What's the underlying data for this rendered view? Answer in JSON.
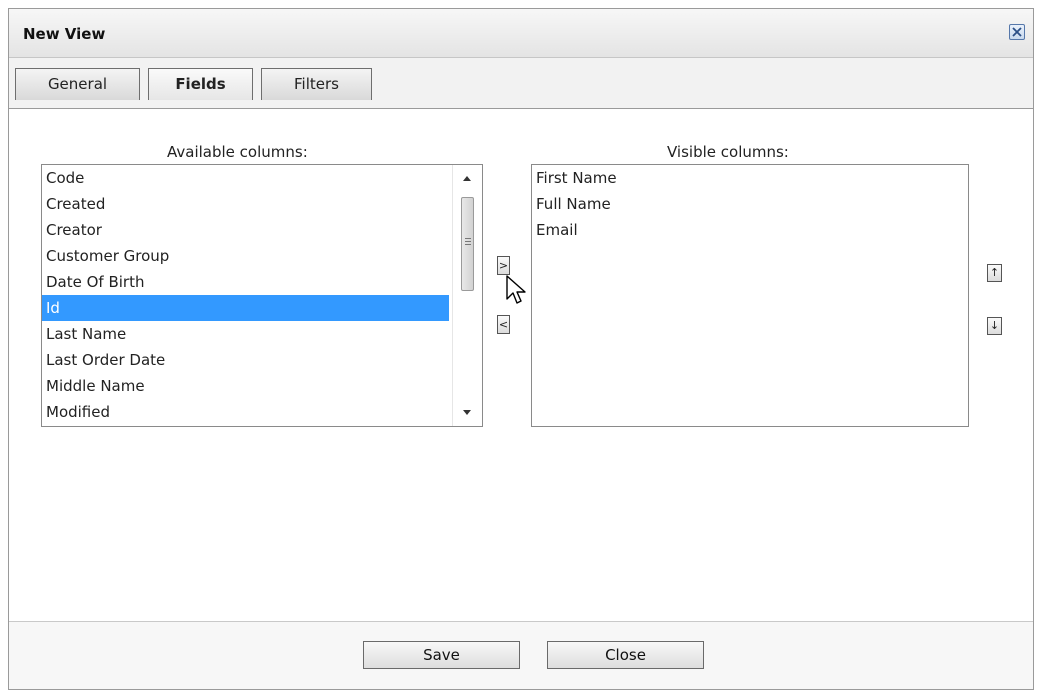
{
  "dialog": {
    "title": "New View"
  },
  "tabs": [
    {
      "label": "General",
      "active": false
    },
    {
      "label": "Fields",
      "active": true
    },
    {
      "label": "Filters",
      "active": false
    }
  ],
  "available": {
    "label": "Available columns:",
    "items": [
      "Code",
      "Created",
      "Creator",
      "Customer Group",
      "Date Of Birth",
      "Id",
      "Last Name",
      "Last Order Date",
      "Middle Name",
      "Modified"
    ],
    "selected": "Id"
  },
  "visible": {
    "label": "Visible columns:",
    "items": [
      "First Name",
      "Full Name",
      "Email"
    ]
  },
  "buttons": {
    "add": ">",
    "remove": "<",
    "move_up": "↑",
    "move_down": "↓",
    "save": "Save",
    "close": "Close"
  },
  "icons": {
    "close": "close-icon",
    "cursor": "arrow-cursor-icon"
  },
  "colors": {
    "selection": "#3399ff",
    "close_icon_border": "#5577aa"
  }
}
